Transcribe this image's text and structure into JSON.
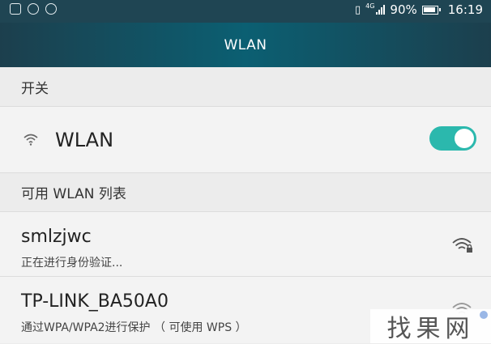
{
  "status_bar": {
    "network_type": "4G",
    "battery_percent": "90%",
    "time": "16:19"
  },
  "title_bar": {
    "title": "WLAN"
  },
  "switch_section": {
    "header": "开关"
  },
  "wlan_switch": {
    "label": "WLAN",
    "state": "on",
    "accent_color": "#2bb8ad"
  },
  "available_section": {
    "header": "可用 WLAN 列表"
  },
  "networks": [
    {
      "ssid": "smlzjwc",
      "status": "正在进行身份验证...",
      "icon": "wifi-locked-icon"
    },
    {
      "ssid": "TP-LINK_BA50A0",
      "status": "通过WPA/WPA2进行保护 （ 可使用 WPS ）",
      "icon": "wifi-locked-icon"
    }
  ],
  "watermark": {
    "text": "找果网"
  }
}
